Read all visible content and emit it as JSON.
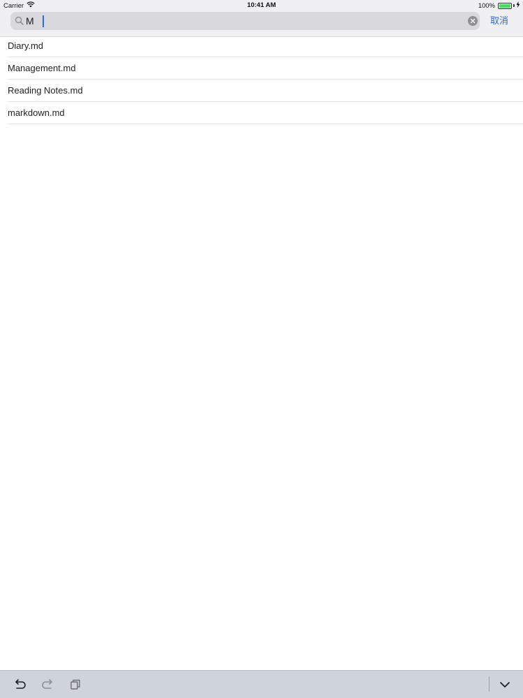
{
  "status_bar": {
    "carrier": "Carrier",
    "time": "10:41 AM",
    "battery_text": "100%",
    "battery_level": 1.0
  },
  "search": {
    "value": "M",
    "placeholder": "",
    "cancel_label": "取消"
  },
  "results": [
    {
      "name": "Diary.md"
    },
    {
      "name": "Management.md"
    },
    {
      "name": "Reading Notes.md"
    },
    {
      "name": "markdown.md"
    }
  ],
  "toolbar": {
    "icons": [
      "undo-icon",
      "redo-icon",
      "paste-icon",
      "dismiss-keyboard-icon"
    ]
  },
  "colors": {
    "accent": "#2f6bd6",
    "battery": "#4cd964",
    "toolbar_bg": "#cfd3da"
  }
}
